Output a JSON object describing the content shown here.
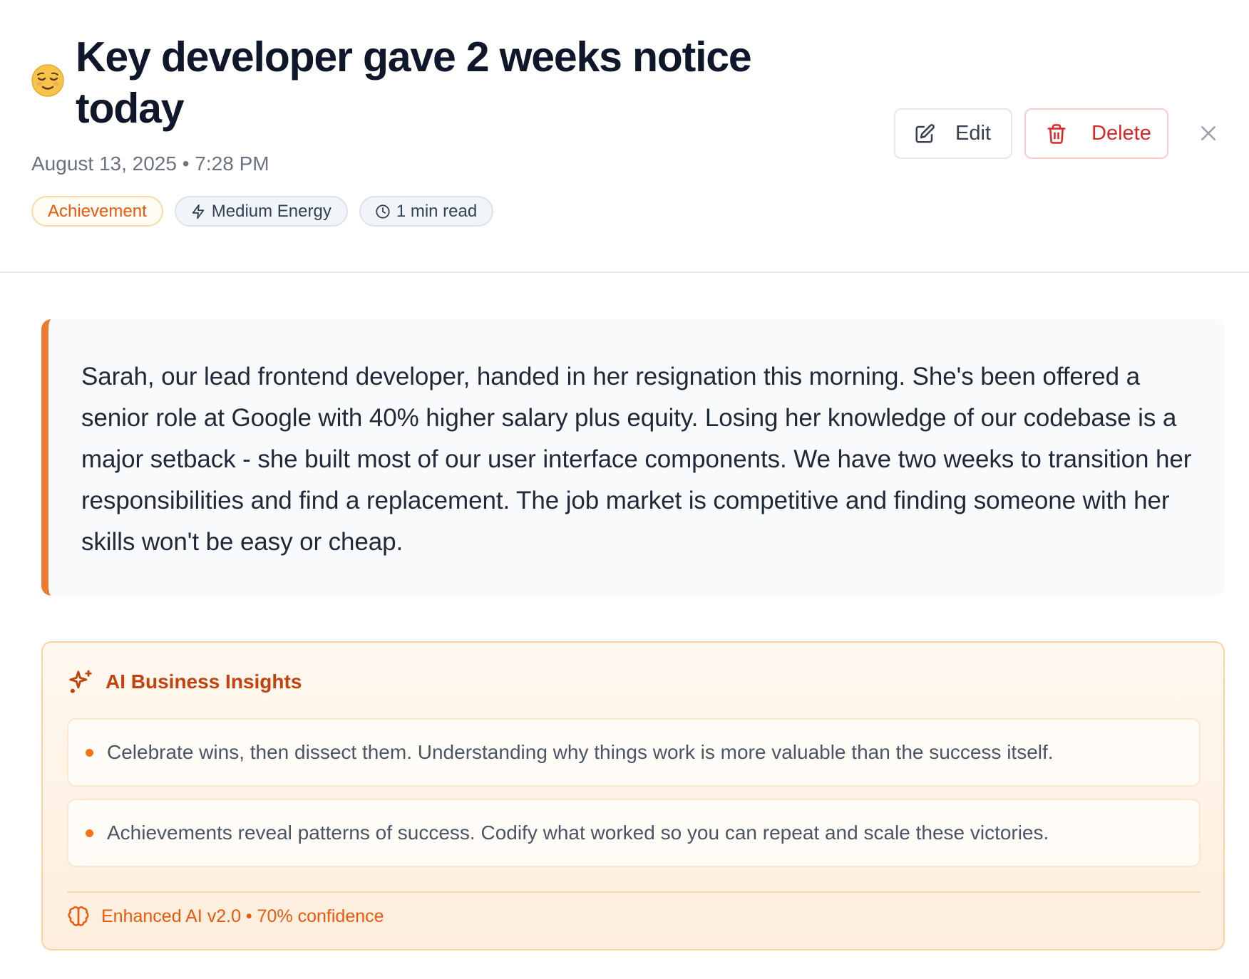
{
  "entry": {
    "mood_emoji": "😌",
    "title": "Key developer gave 2 weeks notice today",
    "timestamp": "August 13, 2025 • 7:28 PM",
    "tags": {
      "category": "Achievement",
      "energy": "Medium Energy",
      "read_time": "1 min read"
    },
    "body": "Sarah, our lead frontend developer, handed in her resignation this morning. She's been offered a senior role at Google with 40% higher salary plus equity. Losing her knowledge of our codebase is a major setback - she built most of our user interface components. We have two weeks to transition her responsibilities and find a replacement. The job market is competitive and finding someone with her skills won't be easy or cheap."
  },
  "actions": {
    "edit_label": "Edit",
    "delete_label": "Delete"
  },
  "insights": {
    "title": "AI Business Insights",
    "items": [
      "Celebrate wins, then dissect them. Understanding why things work is more valuable than the success itself.",
      "Achievements reveal patterns of success. Codify what worked so you can repeat and scale these victories."
    ],
    "footer": "Enhanced AI v2.0 • 70% confidence"
  },
  "colors": {
    "accent": "#ea580c",
    "danger": "#dc2626",
    "border_accent": "#ea7a32"
  },
  "icons": {
    "mood": "relieved-face-emoji",
    "energy": "lightning-icon",
    "read_time": "clock-icon",
    "edit": "pencil-square-icon",
    "delete": "trash-icon",
    "close": "close-icon",
    "insights": "sparkles-icon",
    "footer": "brain-icon"
  }
}
